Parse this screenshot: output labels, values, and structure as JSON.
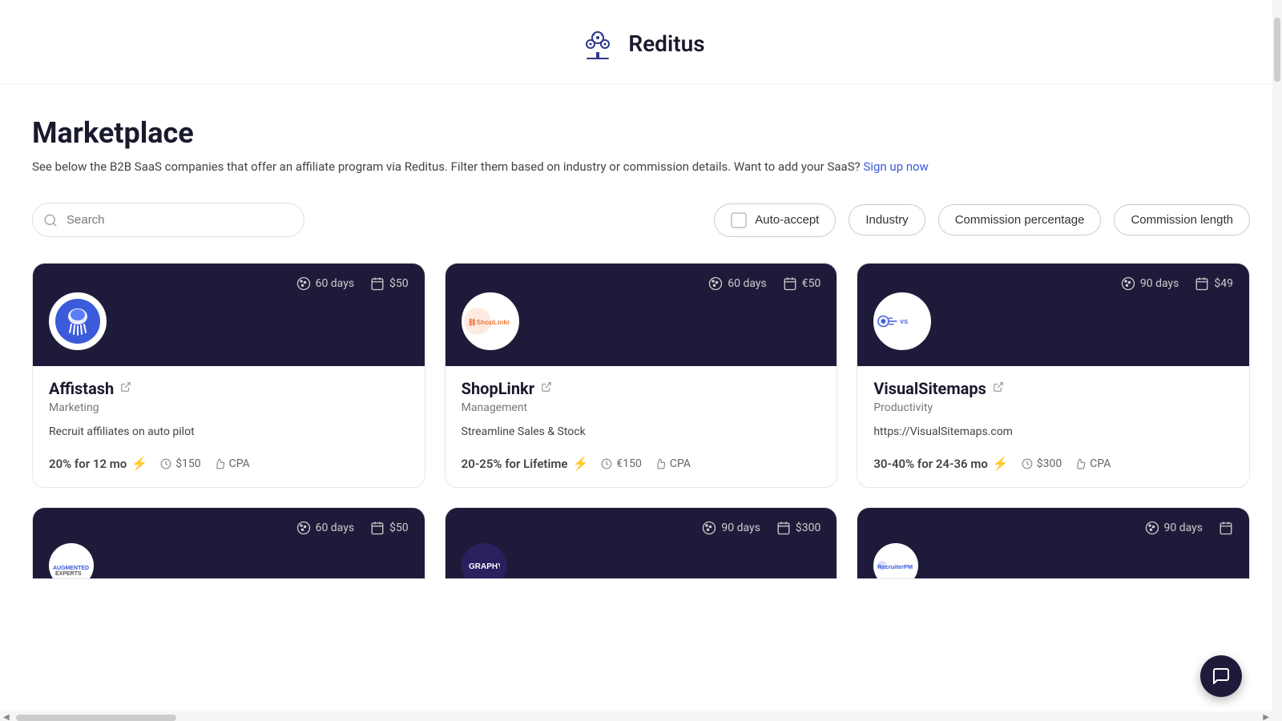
{
  "header": {
    "logo_text": "Reditus",
    "logo_alt": "Reditus logo"
  },
  "page": {
    "title": "Marketplace",
    "subtitle": "See below the B2B SaaS companies that offer an affiliate program via Reditus. Filter them based on industry or commission details. Want to add your SaaS?",
    "cta_link": "Sign up now"
  },
  "filters": {
    "search_placeholder": "Search",
    "auto_accept_label": "Auto-accept",
    "industry_label": "Industry",
    "commission_percentage_label": "Commission percentage",
    "commission_length_label": "Commission length"
  },
  "cards": [
    {
      "id": "affistash",
      "name": "Affistash",
      "category": "Marketing",
      "description": "Recruit affiliates on auto pilot",
      "days": "60 days",
      "amount": "$50",
      "commission": "20% for 12 mo",
      "min_payout": "$150",
      "commission_type": "CPA"
    },
    {
      "id": "shoplinkr",
      "name": "ShopLinkr",
      "category": "Management",
      "description": "Streamline Sales & Stock",
      "days": "60 days",
      "amount": "€50",
      "commission": "20-25% for Lifetime",
      "min_payout": "€150",
      "commission_type": "CPA"
    },
    {
      "id": "visualsitemaps",
      "name": "VisualSitemaps",
      "category": "Productivity",
      "description": "https://VisualSitemaps.com",
      "days": "90 days",
      "amount": "$49",
      "commission": "30-40% for 24-36 mo",
      "min_payout": "$300",
      "commission_type": "CPA"
    }
  ],
  "cards_row2": [
    {
      "id": "augmented-experts",
      "name": "Augmented Experts",
      "days": "60 days",
      "amount": "$50"
    },
    {
      "id": "graphy",
      "name": "Graphy",
      "days": "90 days",
      "amount": "$300"
    },
    {
      "id": "recruiterpm",
      "name": "RecruiterPM",
      "days": "90 days",
      "amount": ""
    }
  ]
}
